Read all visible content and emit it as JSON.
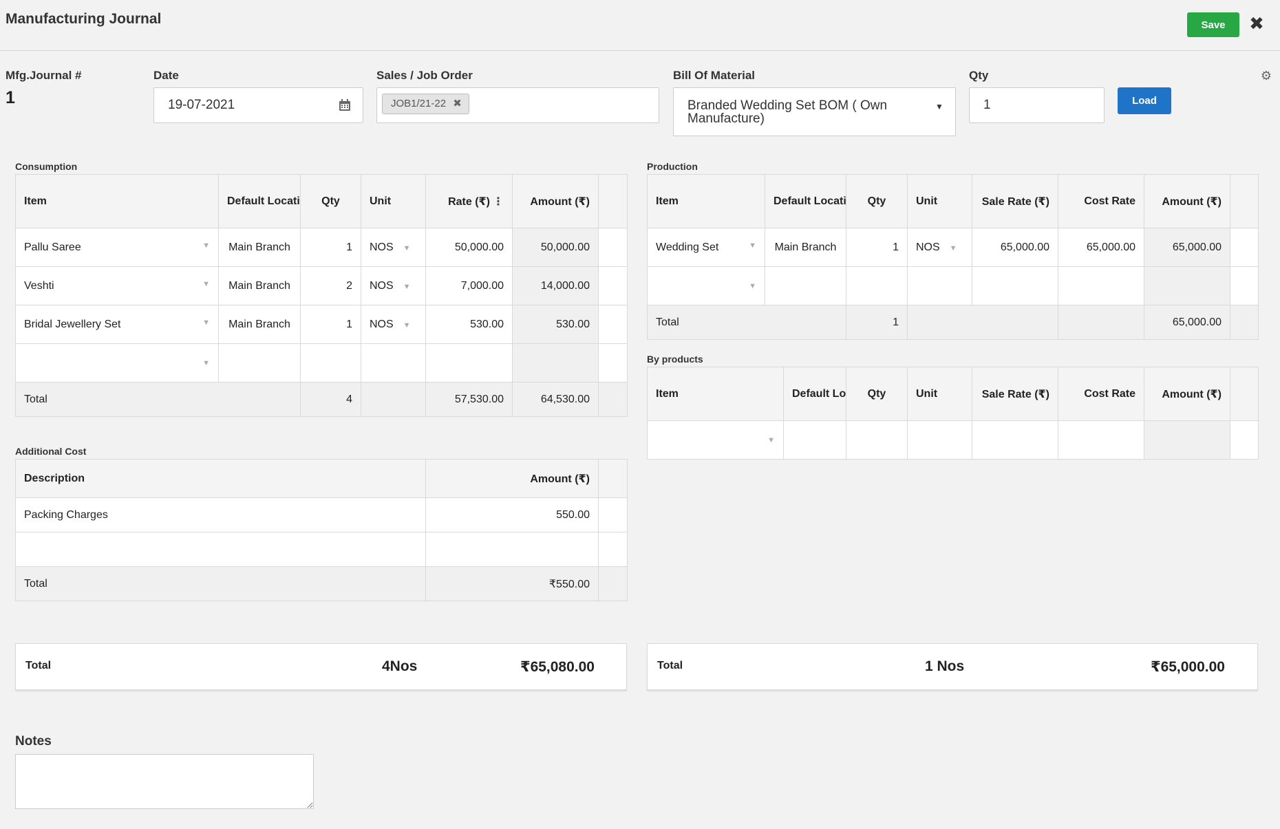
{
  "header": {
    "title": "Manufacturing Journal",
    "save_label": "Save",
    "close_icon": "close-icon",
    "settings_icon": "gear-icon"
  },
  "form": {
    "journal_no_label": "Mfg.Journal #",
    "journal_no": "1",
    "date_label": "Date",
    "date_value": "19-07-2021",
    "sales_order_label": "Sales / Job Order",
    "sales_order_tag": "JOB1/21-22",
    "bom_label": "Bill Of Material",
    "bom_value": "Branded Wedding Set BOM ( Own Manufacture)",
    "qty_label": "Qty",
    "qty_value": "1",
    "load_label": "Load"
  },
  "consumption": {
    "title": "Consumption",
    "headers": [
      "Item",
      "Default Location",
      "Qty",
      "Unit",
      "Rate (₹)",
      "Amount (₹)"
    ],
    "rows": [
      {
        "item": "Pallu Saree",
        "location": "Main Branch",
        "qty": "1",
        "unit": "NOS",
        "rate": "50,000.00",
        "amount": "50,000.00"
      },
      {
        "item": "Veshti",
        "location": "Main Branch",
        "qty": "2",
        "unit": "NOS",
        "rate": "7,000.00",
        "amount": "14,000.00"
      },
      {
        "item": "Bridal Jewellery Set",
        "location": "Main Branch",
        "qty": "1",
        "unit": "NOS",
        "rate": "530.00",
        "amount": "530.00"
      }
    ],
    "total": {
      "label": "Total",
      "qty": "4",
      "rate": "57,530.00",
      "amount": "64,530.00"
    }
  },
  "production": {
    "title": "Production",
    "headers": [
      "Item",
      "Default Location",
      "Qty",
      "Unit",
      "Sale Rate (₹)",
      "Cost Rate",
      "Amount (₹)"
    ],
    "rows": [
      {
        "item": "Wedding Set",
        "location": "Main Branch",
        "qty": "1",
        "unit": "NOS",
        "sale_rate": "65,000.00",
        "cost_rate": "65,000.00",
        "amount": "65,000.00"
      }
    ],
    "total": {
      "label": "Total",
      "qty": "1",
      "amount": "65,000.00"
    }
  },
  "byproducts": {
    "title": "By products",
    "headers": [
      "Item",
      "Default Location",
      "Qty",
      "Unit",
      "Sale Rate (₹)",
      "Cost Rate",
      "Amount (₹)"
    ]
  },
  "additional_cost": {
    "title": "Additional Cost",
    "headers": [
      "Description",
      "Amount (₹)"
    ],
    "rows": [
      {
        "description": "Packing Charges",
        "amount": "550.00"
      }
    ],
    "total": {
      "label": "Total",
      "amount": "₹550.00"
    }
  },
  "summary_left": {
    "label": "Total",
    "qty": "4Nos",
    "amount": "₹65,080.00"
  },
  "summary_right": {
    "label": "Total",
    "qty": "1 Nos",
    "amount": "₹65,000.00"
  },
  "notes": {
    "label": "Notes",
    "value": ""
  }
}
